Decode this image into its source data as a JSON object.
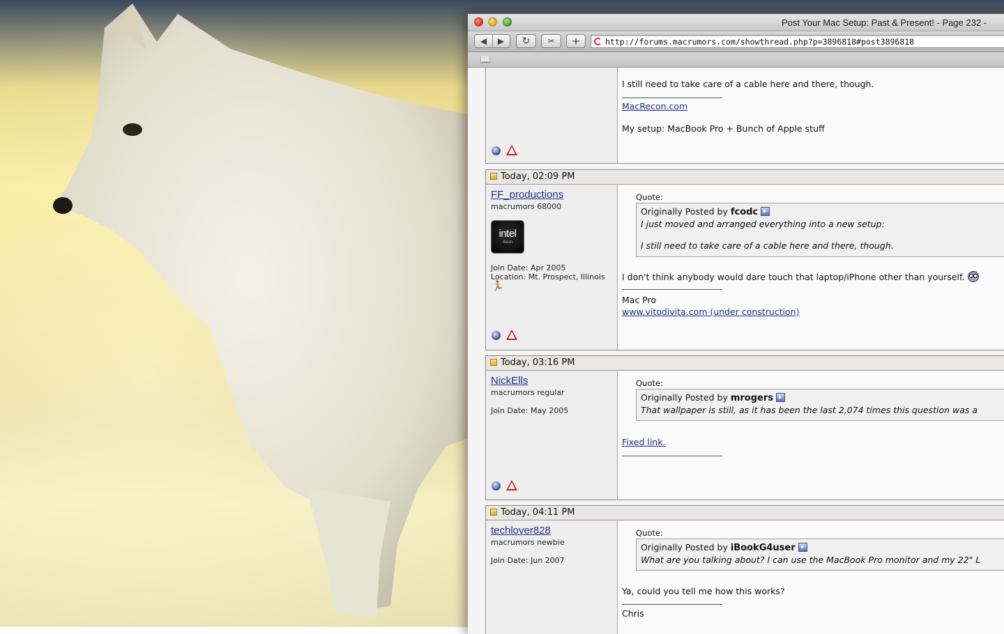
{
  "window": {
    "title": "Post Your Mac Setup: Past & Present! - Page 232 -",
    "url": "http://forums.macrumors.com/showthread.php?p=3896818#post3896818"
  },
  "toolbar": {
    "back_label": "◀",
    "forward_label": "▶",
    "reload_label": "↻",
    "snip_label": "✂",
    "add_label": "+"
  },
  "bookmarks": {
    "icon": "book-icon"
  },
  "posts": [
    {
      "body_lines": [
        "I still need to take care of a cable here and there, though."
      ],
      "signature": {
        "link": "MacRecon.com",
        "text": "My setup: MacBook Pro + Bunch of Apple stuff"
      }
    },
    {
      "date": "Today, 02:09 PM",
      "username": "FF_productions",
      "user_title": "macrumors 68000",
      "avatar": {
        "line1": "intel",
        "line2": "Xeon"
      },
      "join_date": "Join Date: Apr 2005",
      "location": "Location: Mt. Prospect, Illinois",
      "quote": {
        "label": "Quote:",
        "by_prefix": "Originally Posted by",
        "author": "fcodc",
        "lines": [
          "I just moved and arranged everything into a new setup:",
          "I still need to take care of a cable here and there, though."
        ]
      },
      "body": "I don't think anybody would dare touch that laptop/iPhone other than yourself.",
      "signature": {
        "text": "Mac Pro",
        "link": "www.vitodivita.com (under construction)"
      }
    },
    {
      "date": "Today, 03:16 PM",
      "username": "NickElls",
      "user_title": "macrumors regular",
      "join_date": "Join Date: May 2005",
      "quote": {
        "label": "Quote:",
        "by_prefix": "Originally Posted by",
        "author": "mrogers",
        "lines": [
          "That wallpaper is still, as it has been the last 2,074 times this question was a"
        ]
      },
      "body_link": "Fixed link."
    },
    {
      "date": "Today, 04:11 PM",
      "username": "techlover828",
      "user_title": "macrumors newbie",
      "join_date": "Join Date: Jun 2007",
      "quote": {
        "label": "Quote:",
        "by_prefix": "Originally Posted by",
        "author": "iBookG4user",
        "lines": [
          "What are you talking about? I can use the MacBook Pro monitor and my 22\" L"
        ]
      },
      "body": "Ya, could you tell me how this works?",
      "signature": {
        "text": "Chris"
      }
    }
  ]
}
